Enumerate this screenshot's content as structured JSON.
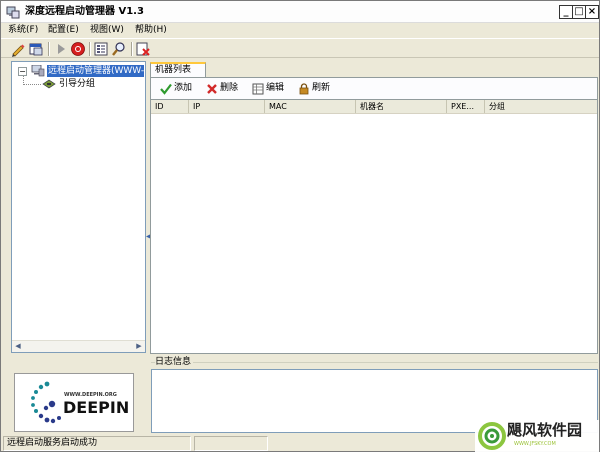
{
  "window": {
    "title": "深度远程启动管理器 V1.3",
    "controls": {
      "minimize": "_",
      "maximize": "□",
      "close": "×"
    }
  },
  "menu": [
    {
      "label": "系统(F)"
    },
    {
      "label": "配置(E)"
    },
    {
      "label": "视图(W)"
    },
    {
      "label": "帮助(H)"
    }
  ],
  "toolbar": {
    "icons": [
      "pencil-icon",
      "window-icon",
      "play-icon",
      "stop-icon",
      "list-icon",
      "search-icon",
      "delete-icon"
    ]
  },
  "tree": {
    "root_label": "远程启动管理器(WWW-8",
    "child_label": "引导分组"
  },
  "tab": {
    "label": "机器列表"
  },
  "actions": [
    {
      "label": "添加",
      "icon": "check-icon",
      "color": "#2e9a2e"
    },
    {
      "label": "删除",
      "icon": "red-x-icon",
      "color": "#d22a2a"
    },
    {
      "label": "编辑",
      "icon": "table-icon",
      "color": "#5a5a5a"
    },
    {
      "label": "刷新",
      "icon": "lock-icon",
      "color": "#b07a1c"
    }
  ],
  "table": {
    "columns": [
      "ID",
      "IP",
      "MAC",
      "机器名",
      "PXE...",
      "分组"
    ],
    "rows": []
  },
  "log": {
    "label": "日志信息"
  },
  "logo": {
    "url": "WWW.DEEPIN.ORG",
    "name": "DEEPIN"
  },
  "status": {
    "message": "远程启动服务启动成功"
  },
  "watermark": {
    "text": "飓风软件园",
    "url": "WWW.JFSKY.COM"
  }
}
